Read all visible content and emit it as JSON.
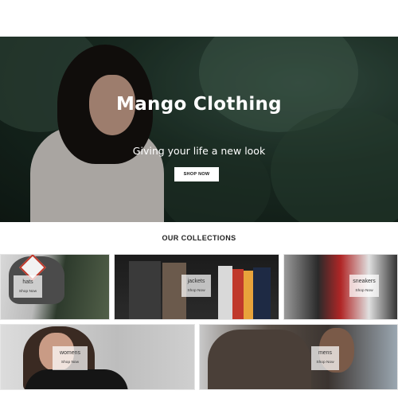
{
  "hero": {
    "title": "Mango Clothing",
    "subtitle": "Giving your life a new look",
    "button_label": "SHOP NOW"
  },
  "collections": {
    "heading": "OUR COLLECTIONS",
    "items": [
      {
        "label": "hats",
        "cta": "Shop Now"
      },
      {
        "label": "jackets",
        "cta": "Shop Now"
      },
      {
        "label": "sneakers",
        "cta": "Shop Now"
      },
      {
        "label": "womens",
        "cta": "Shop Now"
      },
      {
        "label": "mens",
        "cta": "Shop Now"
      }
    ]
  }
}
